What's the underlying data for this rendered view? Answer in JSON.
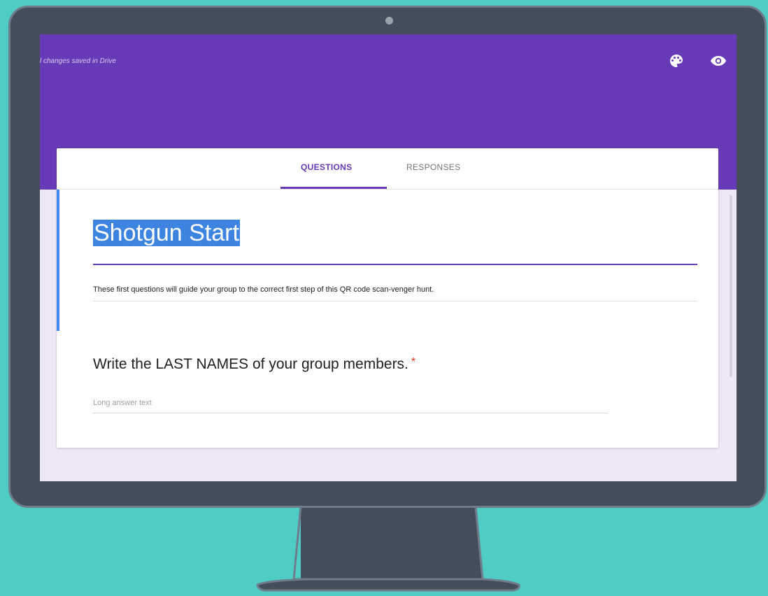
{
  "header": {
    "save_status": "l changes saved in Drive",
    "icons": [
      "palette-icon",
      "eye-icon"
    ]
  },
  "tabs": [
    {
      "label": "QUESTIONS",
      "active": true
    },
    {
      "label": "RESPONSES",
      "active": false
    }
  ],
  "form": {
    "title": "Shotgun Start",
    "description": "These first questions will guide your group to the correct first step of this QR code scan-venger hunt."
  },
  "question": {
    "title": "Write the LAST NAMES of your group members.",
    "required_mark": "*",
    "placeholder": "Long answer text"
  },
  "colors": {
    "background": "#4fcdc4",
    "monitor": "#444e5a",
    "header": "#673ab7",
    "page": "#ede7f6",
    "selection": "#3d84e0"
  }
}
